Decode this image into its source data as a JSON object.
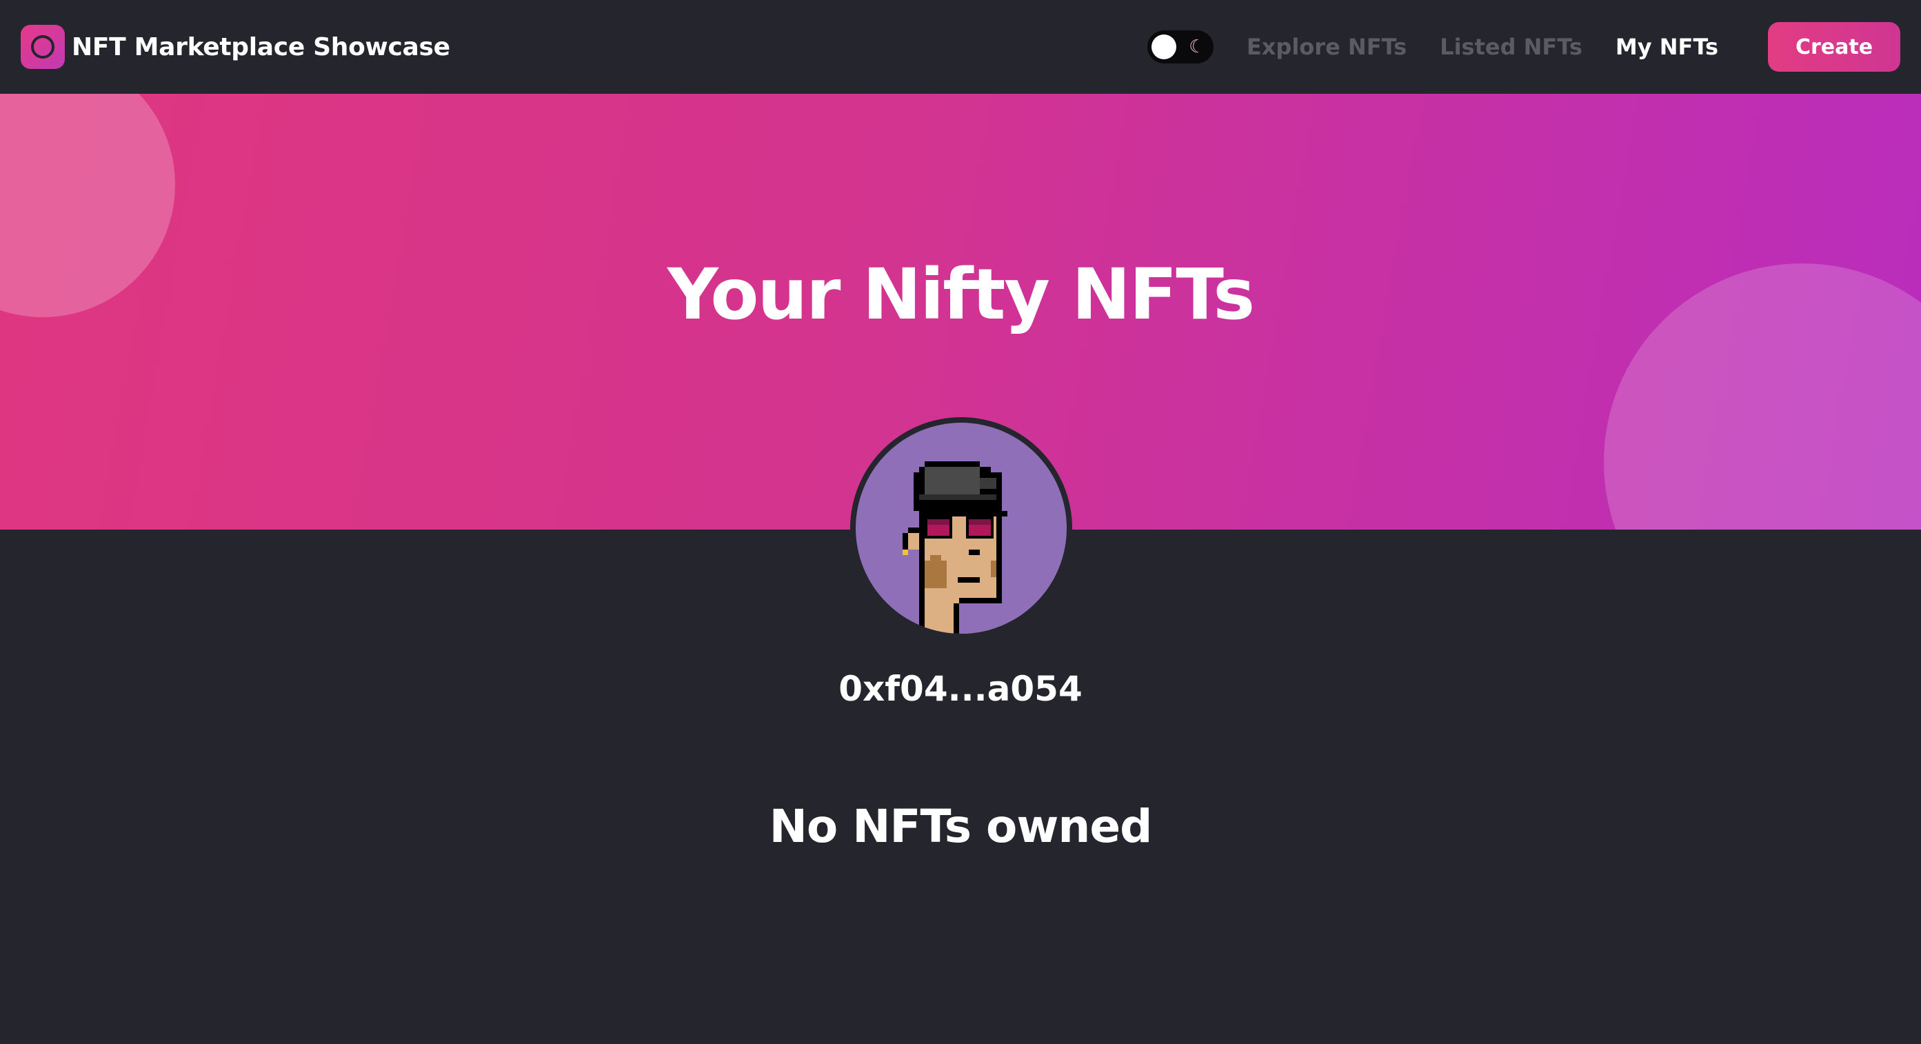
{
  "header": {
    "brand_name": "NFT Marketplace Showcase",
    "logo_icon": "ring-logo-icon",
    "theme_toggle": {
      "state": "dark",
      "icon": "moon-icon",
      "moon_glyph": "☾"
    },
    "nav": [
      {
        "label": "Explore NFTs",
        "active": false
      },
      {
        "label": "Listed NFTs",
        "active": false
      },
      {
        "label": "My NFTs",
        "active": true
      }
    ],
    "create_label": "Create"
  },
  "banner": {
    "title": "Your Nifty NFTs"
  },
  "profile": {
    "avatar_icon": "pixel-punk-avatar",
    "address": "0xf04...a054"
  },
  "content": {
    "empty_message": "No NFTs owned"
  },
  "colors": {
    "background": "#24252d",
    "accent_start": "#df3680",
    "accent_end": "#b92dbd",
    "nav_inactive": "#5a5b63"
  }
}
